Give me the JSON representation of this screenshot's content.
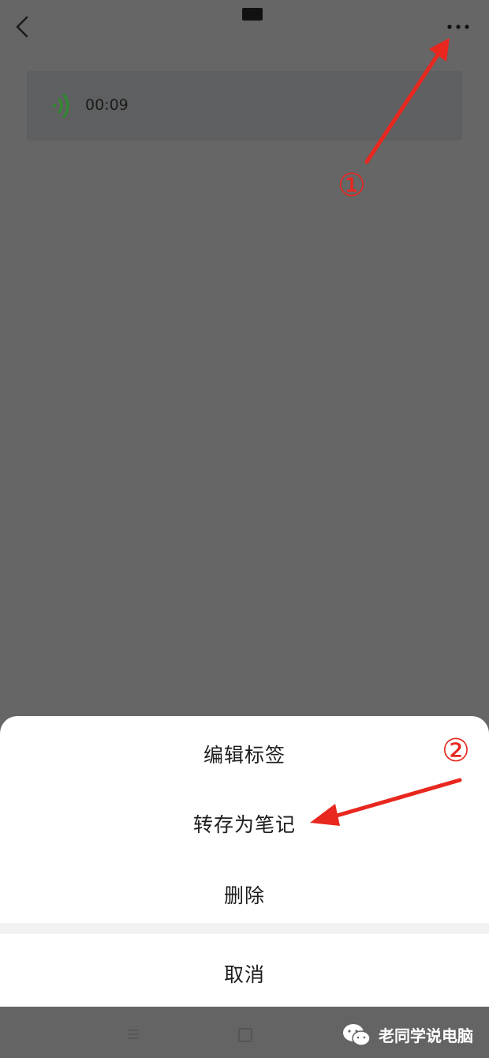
{
  "header": {
    "back_icon": "chevron-left-icon",
    "more_icon": "more-horizontal-icon"
  },
  "voice_note": {
    "duration": "00:09",
    "icon": "voice-wave-icon",
    "icon_color": "#2e8b2e"
  },
  "annotations": {
    "marker_1": "①",
    "marker_2": "②",
    "color": "#e8271f"
  },
  "action_sheet": {
    "items": [
      {
        "label": "编辑标签"
      },
      {
        "label": "转存为笔记"
      },
      {
        "label": "删除"
      }
    ],
    "cancel_label": "取消"
  },
  "watermark": {
    "text": "老同学说电脑",
    "icon": "wechat-icon"
  }
}
